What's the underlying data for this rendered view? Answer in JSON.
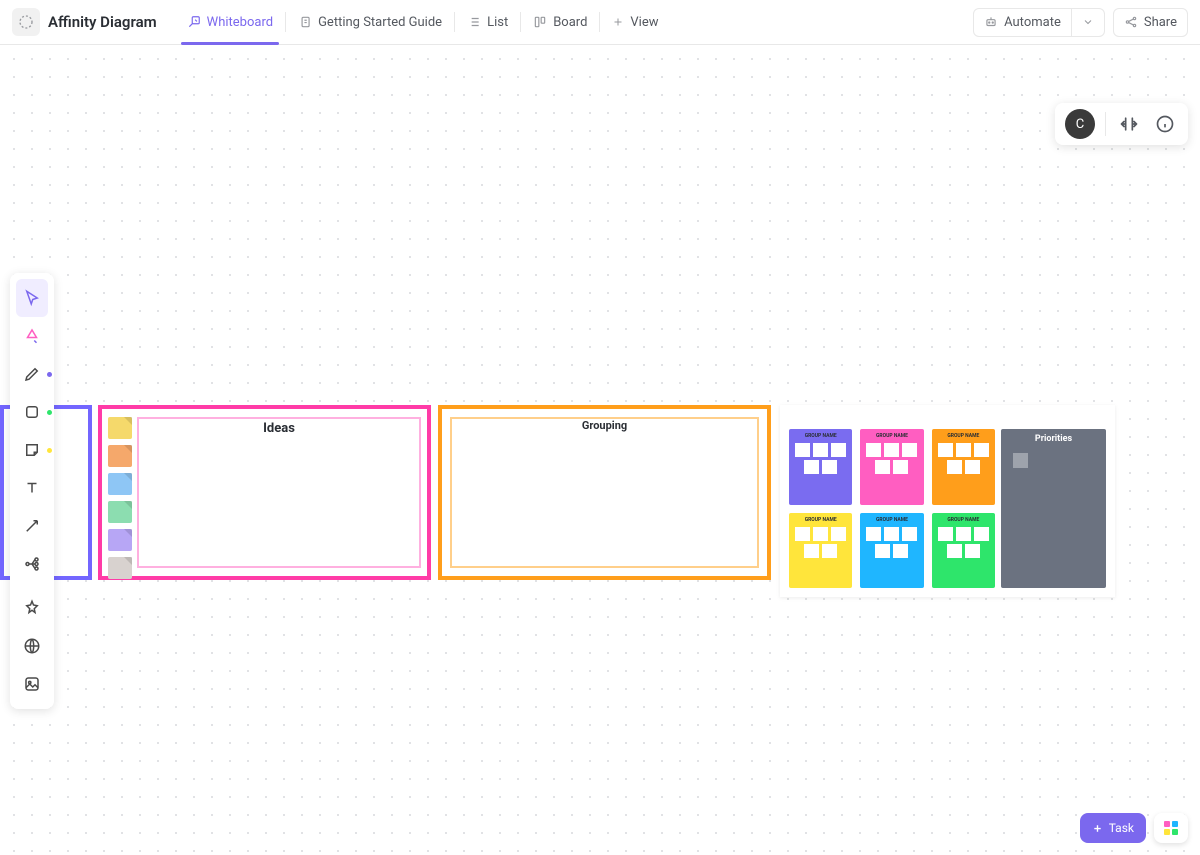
{
  "header": {
    "title": "Affinity Diagram",
    "tabs": [
      {
        "label": "Whiteboard"
      },
      {
        "label": "Getting Started Guide"
      },
      {
        "label": "List"
      },
      {
        "label": "Board"
      },
      {
        "label": "View"
      }
    ],
    "automate": "Automate",
    "share": "Share"
  },
  "canvas": {
    "user_initial": "C",
    "ideas_title": "Ideas",
    "grouping_title": "Grouping",
    "priorities_title": "Priorities",
    "swatches": [
      "#f5d96b",
      "#f5a86b",
      "#8ec6f5",
      "#8cddb0",
      "#b7a6f5",
      "#d8d2cf"
    ],
    "mini_cards": [
      {
        "label": "GROUP NAME",
        "bg": "#7a6cf0"
      },
      {
        "label": "GROUP NAME",
        "bg": "#ff5ec1"
      },
      {
        "label": "GROUP NAME",
        "bg": "#ff9e1b"
      },
      {
        "label": "GROUP NAME",
        "bg": "#ffe53b"
      },
      {
        "label": "GROUP NAME",
        "bg": "#1fb6ff"
      },
      {
        "label": "GROUP NAME",
        "bg": "#2ee56b"
      }
    ]
  },
  "footer": {
    "task_label": "Task"
  }
}
